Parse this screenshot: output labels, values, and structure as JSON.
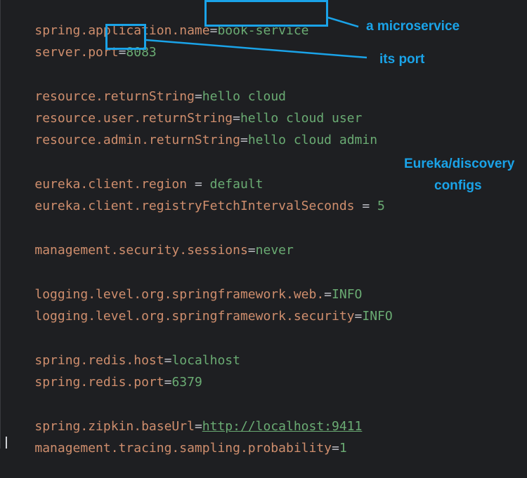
{
  "colors": {
    "background": "#1e1f22",
    "key": "#cf8e6d",
    "separator": "#bcbec4",
    "value": "#6aab73",
    "annotation": "#1aa3e8"
  },
  "lines": [
    {
      "key": "spring.application.name",
      "sep": "=",
      "value": "book-service"
    },
    {
      "key": "server.port",
      "sep": "=",
      "value": "8083"
    },
    {
      "key": "resource.returnString",
      "sep": "=",
      "value": "hello cloud"
    },
    {
      "key": "resource.user.returnString",
      "sep": "=",
      "value": "hello cloud user"
    },
    {
      "key": "resource.admin.returnString",
      "sep": "=",
      "value": "hello cloud admin"
    },
    {
      "key": "eureka.client.region",
      "sep": " = ",
      "value": "default"
    },
    {
      "key": "eureka.client.registryFetchIntervalSeconds",
      "sep": " = ",
      "value": "5"
    },
    {
      "key": "management.security.sessions",
      "sep": "=",
      "value": "never"
    },
    {
      "key": "logging.level.org.springframework.web.",
      "sep": "=",
      "value": "INFO"
    },
    {
      "key": "logging.level.org.springframework.security",
      "sep": "=",
      "value": "INFO"
    },
    {
      "key": "spring.redis.host",
      "sep": "=",
      "value": "localhost"
    },
    {
      "key": "spring.redis.port",
      "sep": "=",
      "value": "6379"
    },
    {
      "key": "spring.zipkin.baseUrl",
      "sep": "=",
      "value": "http://localhost:9411"
    },
    {
      "key": "management.tracing.sampling.probability",
      "sep": "=",
      "value": "1"
    }
  ],
  "annotations": {
    "microservice": "a microservice",
    "port": "its port",
    "eureka_line1": "Eureka/discovery",
    "eureka_line2": "configs"
  }
}
